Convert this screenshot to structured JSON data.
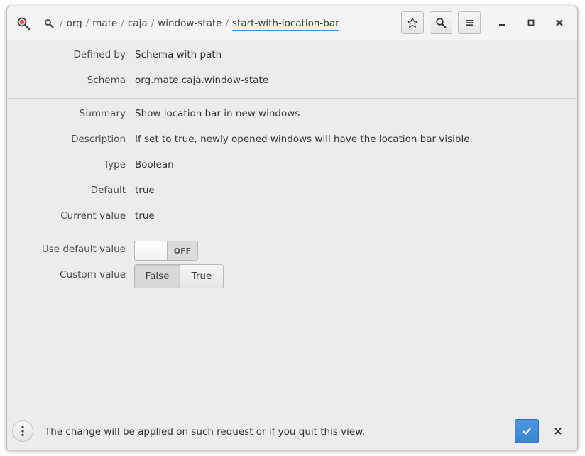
{
  "header": {
    "breadcrumb": [
      "org",
      "mate",
      "caja",
      "window-state"
    ],
    "current": "start-with-location-bar",
    "buttons": {
      "bookmark_icon": "star-icon",
      "search_icon": "search-icon",
      "menu_icon": "hamburger-menu-icon"
    },
    "window_controls": [
      "minimize-icon",
      "maximize-icon",
      "close-icon"
    ]
  },
  "details": {
    "defined_by": {
      "label": "Defined by",
      "value": "Schema with path"
    },
    "schema": {
      "label": "Schema",
      "value": "org.mate.caja.window-state"
    },
    "summary": {
      "label": "Summary",
      "value": "Show location bar in new windows"
    },
    "description": {
      "label": "Description",
      "value": "If set to true, newly opened windows will have the location bar visible."
    },
    "type": {
      "label": "Type",
      "value": "Boolean"
    },
    "default": {
      "label": "Default",
      "value": "true"
    },
    "current_value": {
      "label": "Current value",
      "value": "true"
    }
  },
  "controls": {
    "use_default": {
      "label": "Use default value",
      "state": "OFF"
    },
    "custom_value": {
      "label": "Custom value",
      "options": [
        "False",
        "True"
      ],
      "selected": "False"
    }
  },
  "bottombar": {
    "message": "The change will be applied on such request or if you quit this view."
  },
  "colors": {
    "accent": "#4a90d9",
    "apply_button": "#3a82cf",
    "app_icon": "#c0392b"
  }
}
